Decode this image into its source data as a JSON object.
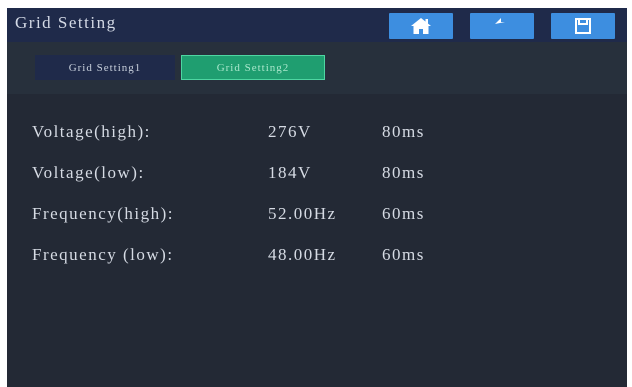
{
  "header": {
    "title": "Grid Setting",
    "buttons": {
      "home_icon": "home-icon",
      "back_icon": "back-arrow-icon",
      "save_icon": "save-icon"
    }
  },
  "tabs": [
    {
      "label": "Grid Setting1",
      "active": false
    },
    {
      "label": "Grid Setting2",
      "active": true
    }
  ],
  "parameters": [
    {
      "label": "Voltage(high):",
      "value": "276V",
      "time": "80ms"
    },
    {
      "label": "Voltage(low):",
      "value": "184V",
      "time": "80ms"
    },
    {
      "label": "Frequency(high):",
      "value": "52.00Hz",
      "time": "60ms"
    },
    {
      "label": "Frequency (low):",
      "value": "48.00Hz",
      "time": "60ms"
    }
  ],
  "colors": {
    "background": "#232935",
    "titlebar": "#1f2a4a",
    "button": "#3d8ee0",
    "active_tab": "#1f9e70",
    "text": "#d6dbe4"
  }
}
